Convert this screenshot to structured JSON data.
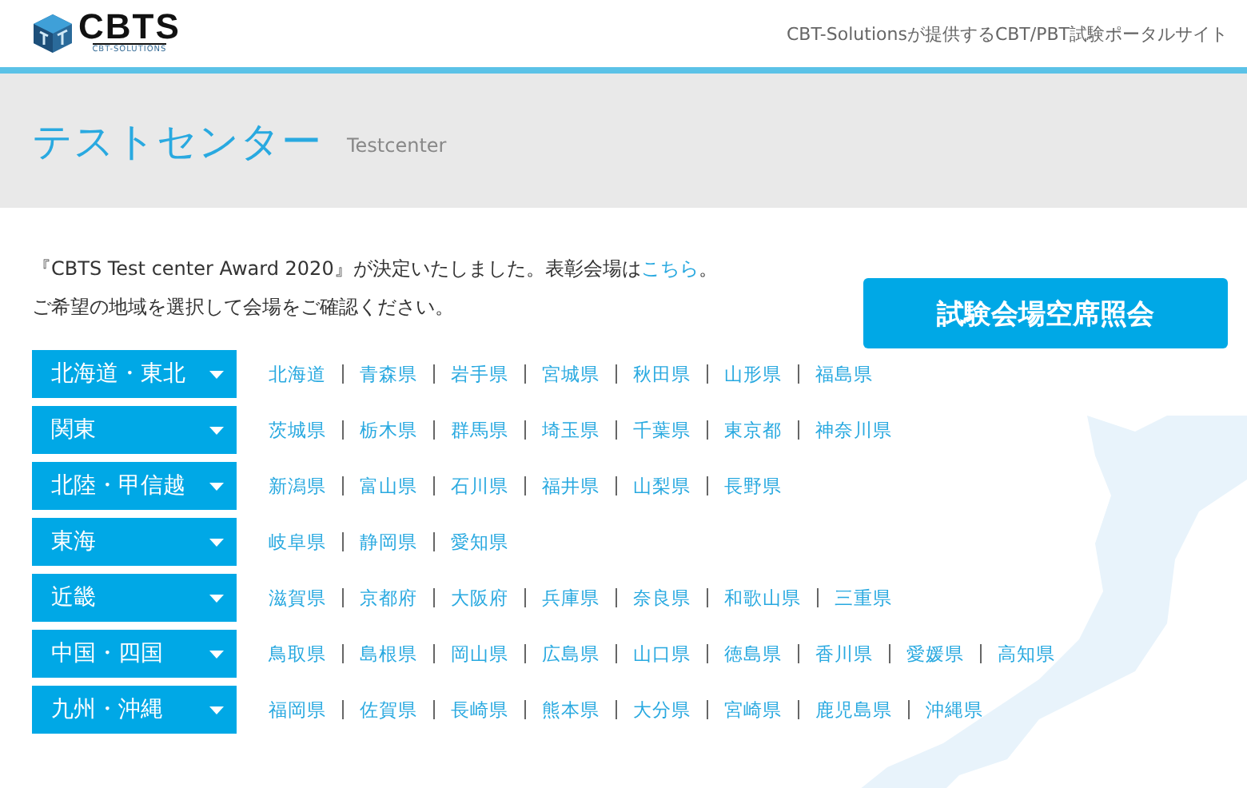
{
  "header": {
    "logo_text": "CBTS",
    "logo_subtext": "CBT-SOLUTIONS",
    "tagline": "CBT-Solutionsが提供するCBT/PBT試験ポータルサイト"
  },
  "page_title": {
    "title": "テストセンター",
    "subtitle": "Testcenter"
  },
  "notice": {
    "before": "『CBTS Test center Award 2020』が決定いたしました。表彰会場は",
    "link": "こちら",
    "after": "。"
  },
  "instruction": "ご希望の地域を選択して会場をご確認ください。",
  "availability_button": "試験会場空席照会",
  "regions": [
    {
      "label": "北海道・東北",
      "expanded": false,
      "prefectures": [
        "北海道",
        "青森県",
        "岩手県",
        "宮城県",
        "秋田県",
        "山形県",
        "福島県"
      ]
    },
    {
      "label": "関東",
      "expanded": false,
      "prefectures": [
        "茨城県",
        "栃木県",
        "群馬県",
        "埼玉県",
        "千葉県",
        "東京都",
        "神奈川県"
      ]
    },
    {
      "label": "北陸・甲信越",
      "expanded": false,
      "prefectures": [
        "新潟県",
        "富山県",
        "石川県",
        "福井県",
        "山梨県",
        "長野県"
      ]
    },
    {
      "label": "東海",
      "expanded": false,
      "prefectures": [
        "岐阜県",
        "静岡県",
        "愛知県"
      ]
    },
    {
      "label": "近畿",
      "expanded": false,
      "prefectures": [
        "滋賀県",
        "京都府",
        "大阪府",
        "兵庫県",
        "奈良県",
        "和歌山県",
        "三重県"
      ]
    },
    {
      "label": "中国・四国",
      "expanded": false,
      "prefectures": [
        "鳥取県",
        "島根県",
        "岡山県",
        "広島県",
        "山口県",
        "徳島県",
        "香川県",
        "愛媛県",
        "高知県"
      ]
    },
    {
      "label": "九州・沖縄",
      "expanded": false,
      "prefectures": [
        "福岡県",
        "佐賀県",
        "長崎県",
        "熊本県",
        "大分県",
        "宮崎県",
        "鹿児島県",
        "沖縄県"
      ]
    }
  ]
}
